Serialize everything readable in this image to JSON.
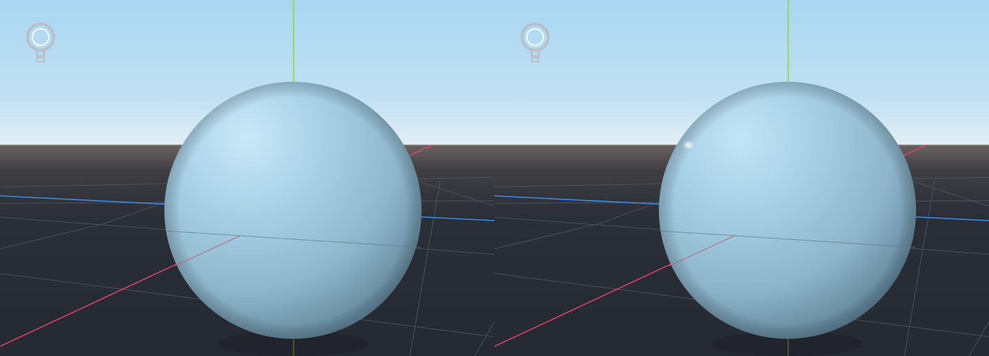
{
  "viewports": [
    {
      "id": "left",
      "light_gizmo_icon": "light-bulb-icon",
      "object": "sphere",
      "specular_highlight": false
    },
    {
      "id": "right",
      "light_gizmo_icon": "light-bulb-icon",
      "object": "sphere",
      "specular_highlight": true
    }
  ],
  "colors": {
    "sky_top": "#a9d6f1",
    "sky_horizon": "#dbeaf4",
    "ground_near": "#262a33",
    "ground_horizon": "#6a6260",
    "grid_line": "#4a4f58",
    "axis_x": "#e8456a",
    "axis_y": "#8ed62e",
    "axis_z": "#3b8ff0",
    "sphere_light": "#bfe3f5",
    "sphere_mid": "#95bfd6",
    "sphere_dark": "#5f8599",
    "gizmo": "#b9bfc6"
  }
}
